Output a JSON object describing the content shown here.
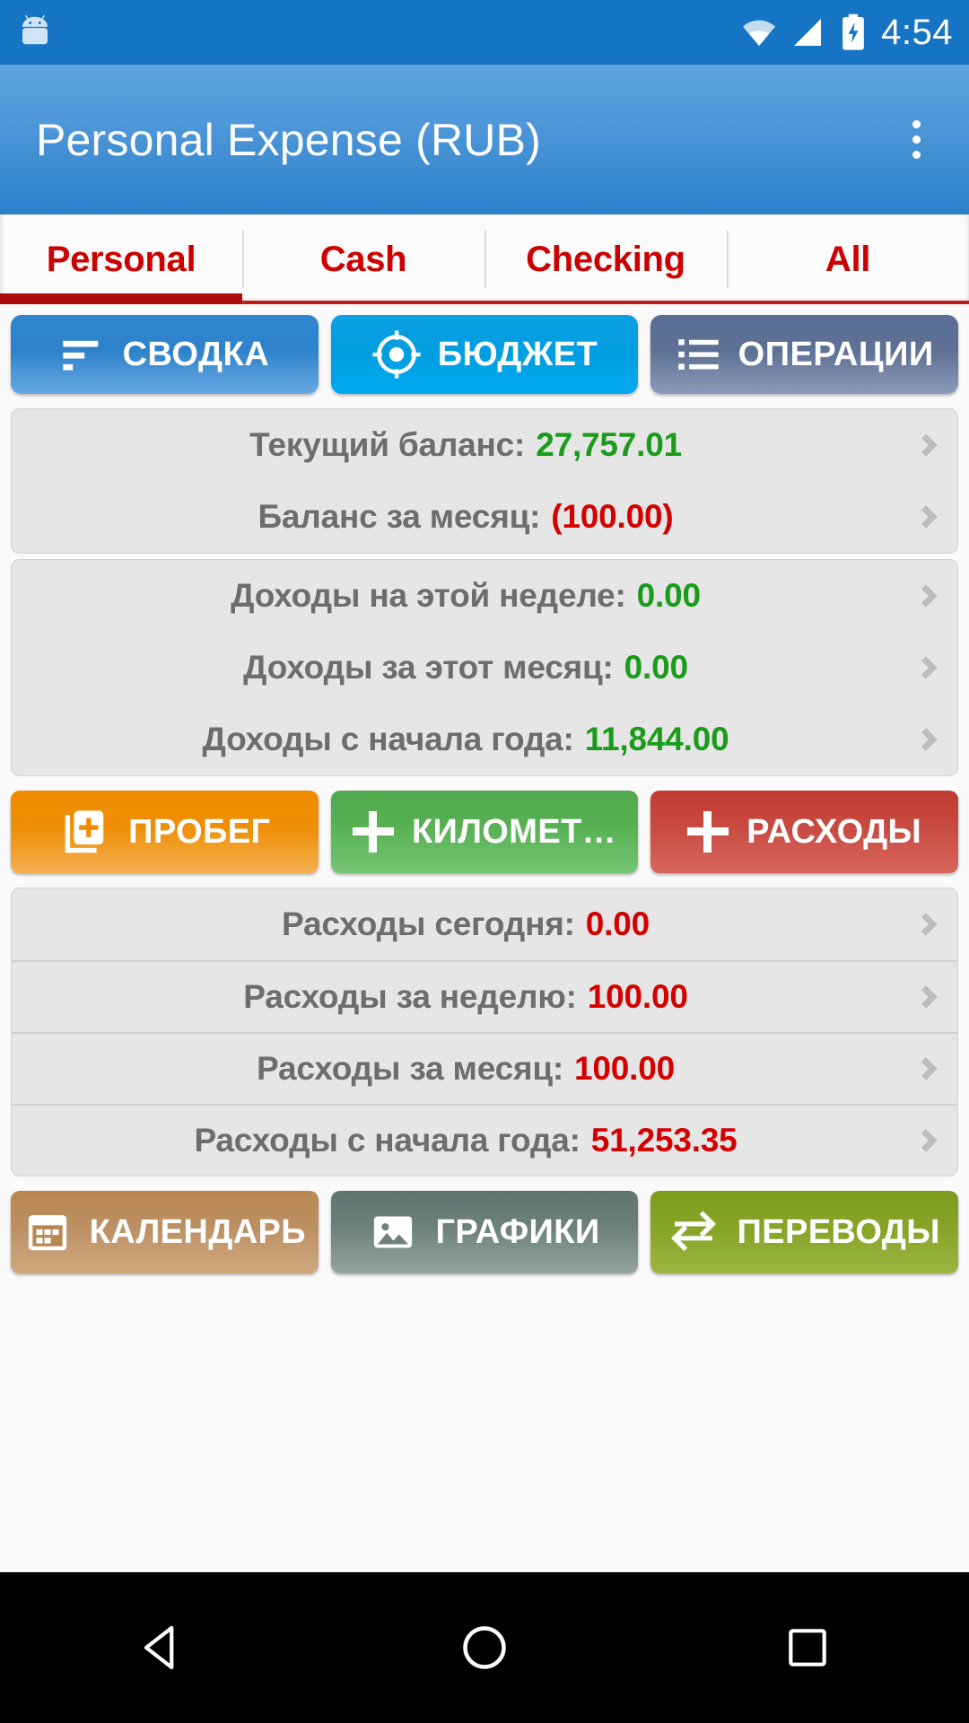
{
  "statusbar": {
    "time": "4:54",
    "icons": [
      "android-robot-icon",
      "wifi-icon",
      "cell-signal-icon",
      "battery-charging-icon"
    ]
  },
  "appbar": {
    "title": "Personal Expense (RUB)",
    "overflow_label": "overflow-menu"
  },
  "tabs": [
    {
      "label": "Personal",
      "active": true
    },
    {
      "label": "Cash",
      "active": false
    },
    {
      "label": "Checking",
      "active": false
    },
    {
      "label": "All",
      "active": false
    }
  ],
  "segments": [
    {
      "label": "СВОДКА",
      "icon": "sort-lines-icon",
      "color": "#2d82cb"
    },
    {
      "label": "БЮДЖЕТ",
      "icon": "target-icon",
      "color": "#009ee0"
    },
    {
      "label": "ОПЕРАЦИИ",
      "icon": "list-bullet-icon",
      "color": "#5e7093"
    }
  ],
  "balance_card": [
    {
      "label": "Текущий баланс:",
      "value": "27,757.01",
      "tone": "green"
    },
    {
      "label": "Баланс за месяц:",
      "value": "(100.00)",
      "tone": "red"
    }
  ],
  "income_card": [
    {
      "label": "Доходы на этой неделе:",
      "value": "0.00",
      "tone": "green"
    },
    {
      "label": "Доходы за этот месяц:",
      "value": "0.00",
      "tone": "green"
    },
    {
      "label": "Доходы с начала года:",
      "value": "11,844.00",
      "tone": "green"
    }
  ],
  "action_buttons": [
    {
      "label": "ПРОБЕГ",
      "icon": "add-document-icon",
      "style": "act-mileage"
    },
    {
      "label": "КИЛОМЕТ…",
      "icon": "plus-icon",
      "style": "act-km"
    },
    {
      "label": "РАСХОДЫ",
      "icon": "plus-icon",
      "style": "act-exp"
    }
  ],
  "expense_card": [
    {
      "label": "Расходы сегодня:",
      "value": "0.00",
      "tone": "red"
    },
    {
      "label": "Расходы за неделю:",
      "value": "100.00",
      "tone": "red"
    },
    {
      "label": "Расходы за месяц:",
      "value": "100.00",
      "tone": "red"
    },
    {
      "label": "Расходы с начала года:",
      "value": "51,253.35",
      "tone": "red"
    }
  ],
  "bottom_buttons": [
    {
      "label": "КАЛЕНДАРЬ",
      "icon": "calendar-icon",
      "style": "act-cal"
    },
    {
      "label": "ГРАФИКИ",
      "icon": "image-chart-icon",
      "style": "act-charts"
    },
    {
      "label": "ПЕРЕВОДЫ",
      "icon": "transfer-arrows-icon",
      "style": "act-transf"
    }
  ],
  "navbar": {
    "back": "back-triangle-icon",
    "home": "home-circle-icon",
    "recents": "recents-square-icon"
  },
  "colors": {
    "appbar": "#2b7fc9",
    "statusbar": "#1574c4",
    "tab_red": "#cc0000",
    "positive": "#1a9c1a",
    "negative": "#d40000"
  }
}
